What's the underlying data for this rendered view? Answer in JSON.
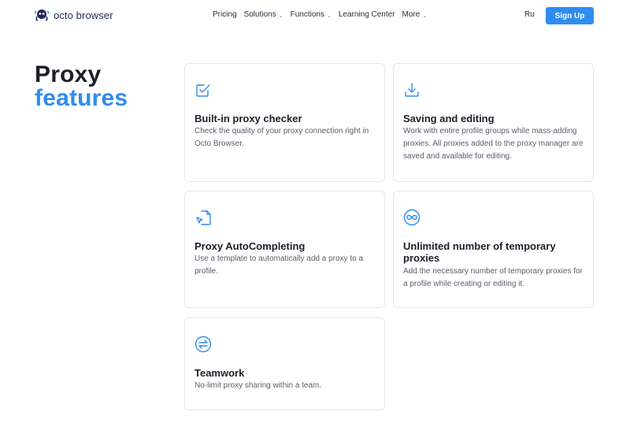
{
  "header": {
    "logo_text": "octo browser",
    "nav": [
      {
        "label": "Pricing",
        "has_dropdown": false
      },
      {
        "label": "Solutions",
        "has_dropdown": true
      },
      {
        "label": "Functions",
        "has_dropdown": true
      },
      {
        "label": "Learning Center",
        "has_dropdown": false
      },
      {
        "label": "More",
        "has_dropdown": true
      }
    ],
    "language": "Ru",
    "signup_label": "Sign Up"
  },
  "heading": {
    "line1": "Proxy",
    "line2": "features"
  },
  "features": [
    {
      "icon": "checkbox-edit-icon",
      "title": "Built-in proxy checker",
      "description": "Check the quality of your proxy connection right in Octo Browser."
    },
    {
      "icon": "download-tray-icon",
      "title": "Saving and editing",
      "description": "Work with entire profile groups while mass-adding proxies. All proxies added to the proxy manager are saved and available for editing."
    },
    {
      "icon": "document-cursor-icon",
      "title": "Proxy AutoCompleting",
      "description": "Use a template to automatically add a proxy to a profile."
    },
    {
      "icon": "infinity-icon",
      "title": "Unlimited number of temporary proxies",
      "description": "Add the necessary number of temporary proxies for a profile while creating or editing it."
    },
    {
      "icon": "swap-arrows-icon",
      "title": "Teamwork",
      "description": "No-limit proxy sharing within a team."
    }
  ],
  "colors": {
    "accent": "#2f8cf0",
    "text": "#1e1e2a",
    "muted": "#5a5e6b",
    "border": "#e4e6ec"
  }
}
